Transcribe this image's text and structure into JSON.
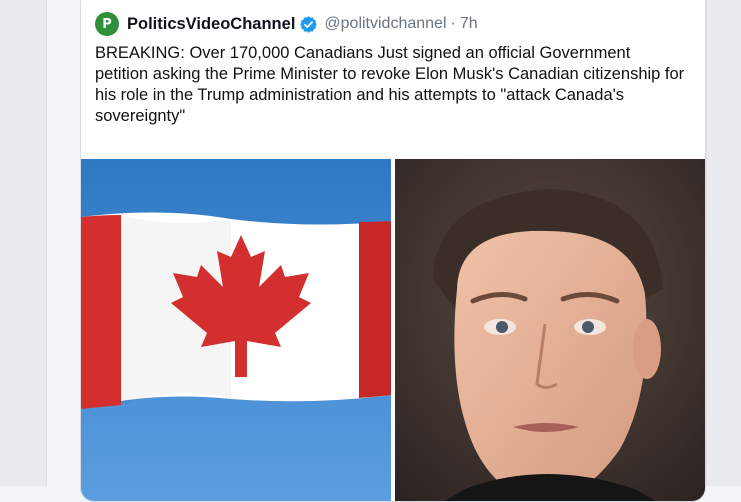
{
  "tweet": {
    "author_name": "PoliticsVideoChannel",
    "author_initial": "P",
    "handle": "@politvidchannel",
    "separator": "·",
    "time": "7h",
    "text": "BREAKING: Over 170,000 Canadians Just signed an official Government petition asking the Prime Minister to revoke Elon Musk's Canadian citizenship for his role in the Trump administration and his attempts to \"attack Canada's sovereignty\""
  },
  "icons": {
    "verified": "verified-badge-icon"
  },
  "colors": {
    "verified_blue": "#1d9bf0",
    "avatar_green": "#2f8f3a",
    "flag_red": "#d32f2f",
    "sky_blue": "#3f86cf"
  }
}
